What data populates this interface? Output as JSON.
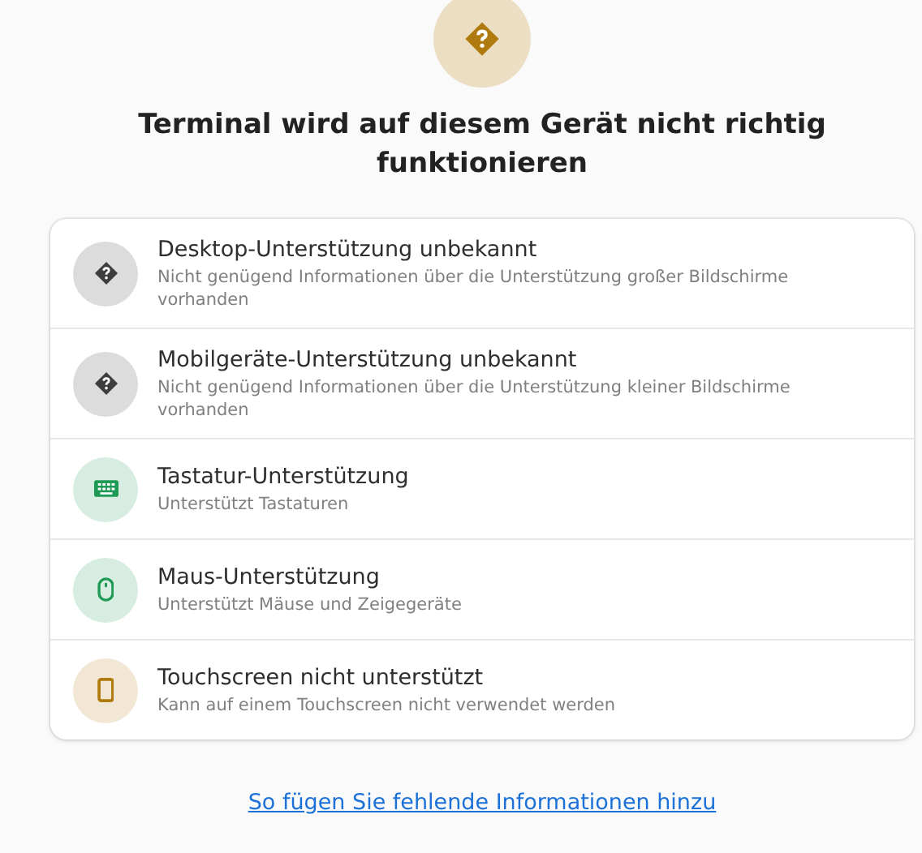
{
  "header": {
    "kind": "question",
    "color": "#b07b0e",
    "title": "Terminal wird auf diesem Gerät nicht richtig funktionieren"
  },
  "items": [
    {
      "kind": "question",
      "color": "#3d3d3d",
      "title": "Desktop-Unterstützung unbekannt",
      "subtitle": "Nicht genügend Informationen über die Unterstützung großer Bildschirme vorhanden"
    },
    {
      "kind": "question",
      "color": "#3d3d3d",
      "title": "Mobilgeräte-Unterstützung unbekannt",
      "subtitle": "Nicht genügend Informationen über die Unterstützung kleiner Bildschirme vorhanden"
    },
    {
      "kind": "keyboard",
      "color": "#1f9956",
      "title": "Tastatur-Unterstützung",
      "subtitle": "Unterstützt Tastaturen"
    },
    {
      "kind": "mouse",
      "color": "#1f9956",
      "title": "Maus-Unterstützung",
      "subtitle": "Unterstützt Mäuse und Zeigegeräte"
    },
    {
      "kind": "phone",
      "color": "#b07b0e",
      "title": "Touchscreen nicht unterstützt",
      "subtitle": "Kann auf einem Touchscreen nicht verwendet werden"
    }
  ],
  "link": "So fügen Sie fehlende Informationen hinzu"
}
